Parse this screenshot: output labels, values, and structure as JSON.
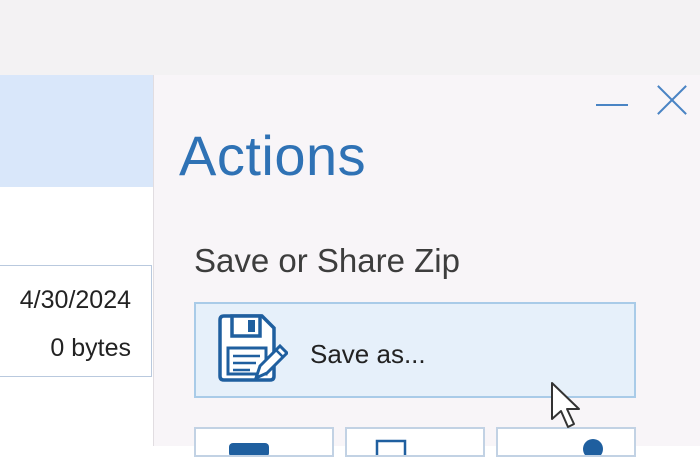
{
  "file_info": {
    "date": "4/30/2024",
    "size": "0 bytes"
  },
  "actions": {
    "title": "Actions",
    "section_title": "Save or Share Zip",
    "save_as_label": "Save as..."
  },
  "icons": {
    "minimize": "minimize-icon",
    "close": "close-icon",
    "save": "floppy-disk-pencil-icon",
    "cursor": "mouse-pointer-icon"
  },
  "colors": {
    "accent": "#2f72b5",
    "selection_bg": "#d9e7fa",
    "button_bg": "#e6f0fa",
    "button_border": "#a9cbe8",
    "panel_bg": "#f8f5f8"
  }
}
